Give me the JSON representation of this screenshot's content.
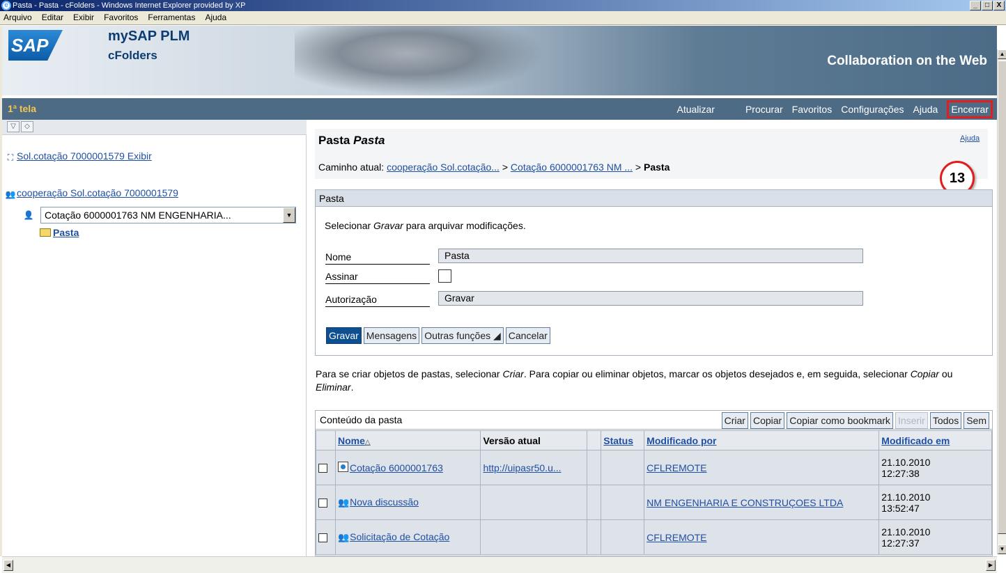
{
  "window": {
    "title": "Pasta - Pasta - cFolders - Windows Internet Explorer provided by XP",
    "controls": [
      "_",
      "□",
      "X"
    ]
  },
  "menu": [
    "Arquivo",
    "Editar",
    "Exibir",
    "Favoritos",
    "Ferramentas",
    "Ajuda"
  ],
  "header": {
    "logo": "SAP",
    "product_line1": "mySAP PLM",
    "product_line2": "cFolders",
    "tagline": "Collaboration on the Web"
  },
  "nav": {
    "screen_title": "1ª tela",
    "links": [
      "Atualizar",
      "Procurar",
      "Favoritos",
      "Configurações",
      "Ajuda"
    ],
    "logout": "Encerrar"
  },
  "tree": {
    "collapse_icon": "▽",
    "expand_icon": "◇",
    "root_link": "Sol.cotação 7000001579 Exibir",
    "cooperation_link": "cooperação Sol.cotação 7000001579",
    "selected_value": "Cotação 6000001763 NM ENGENHARIA...",
    "folder_link": "Pasta"
  },
  "main": {
    "title_prefix": "Pasta",
    "title_italic": "Pasta",
    "help": "Ajuda",
    "breadcrumb_label": "Caminho atual:",
    "breadcrumb_1": "cooperação Sol.cotação...",
    "breadcrumb_2": "Cotação 6000001763 NM ...",
    "breadcrumb_current": "Pasta",
    "callout": "13"
  },
  "form": {
    "box_title": "Pasta",
    "hint_before": "Selecionar ",
    "hint_italic": "Gravar",
    "hint_after": " para arquivar modificações.",
    "name_label": "Nome",
    "name_value": "Pasta",
    "sign_label": "Assinar",
    "auth_label": "Autorização",
    "auth_value": "Gravar",
    "buttons": {
      "save": "Gravar",
      "messages": "Mensagens",
      "other": "Outras funções ◢",
      "cancel": "Cancelar"
    }
  },
  "info": {
    "t1": "Para se criar objetos de pastas, selecionar ",
    "t2": "Criar",
    "t3": ". Para copiar ou eliminar objetos, marcar os objetos desejados e, em seguida, selecionar ",
    "t4": "Copiar",
    "t5": " ou ",
    "t6": "Eliminar",
    "t7": "."
  },
  "contents": {
    "title": "Conteúdo da pasta",
    "actions": {
      "create": "Criar",
      "copy": "Copiar",
      "copy_bookmark": "Copiar como bookmark",
      "insert": "Inserir",
      "all": "Todos",
      "none": "Sem"
    },
    "columns": {
      "name": "Nome",
      "version": "Versão atual",
      "status": "Status",
      "modified_by": "Modificado por",
      "modified_on": "Modificado em"
    },
    "rows": [
      {
        "name": "Cotação 6000001763",
        "version": "http://uipasr50.u...",
        "status": "",
        "modified_by": "CFLREMOTE",
        "date": "21.10.2010",
        "time": "12:27:38"
      },
      {
        "name": "Nova discussão",
        "version": "",
        "status": "",
        "modified_by": "NM ENGENHARIA E CONSTRUÇOES LTDA",
        "date": "21.10.2010",
        "time": "13:52:47"
      },
      {
        "name": "Solicitação de Cotação",
        "version": "",
        "status": "",
        "modified_by": "CFLREMOTE",
        "date": "21.10.2010",
        "time": "12:27:37"
      }
    ]
  }
}
